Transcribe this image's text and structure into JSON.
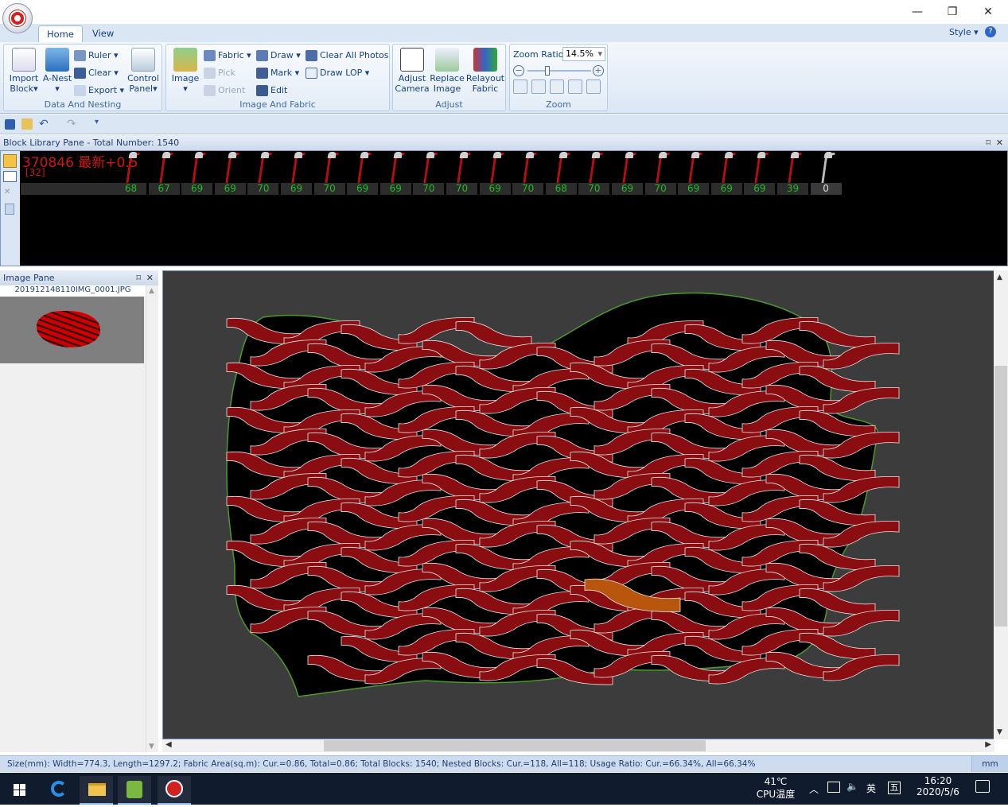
{
  "title_bar": {
    "min": "—",
    "max": "❐",
    "close": "✕"
  },
  "tabs": [
    {
      "label": "Home",
      "active": true
    },
    {
      "label": "View",
      "active": false
    }
  ],
  "style_menu": {
    "label": "Style",
    "help": "?"
  },
  "ribbon": {
    "data_nesting": {
      "label": "Data And Nesting",
      "import_block": "Import\nBlock",
      "import_line1": "Import",
      "import_line2": "Block",
      "anest": "A-Nest",
      "ruler": "Ruler",
      "clear": "Clear",
      "export": "Export",
      "control_line1": "Control",
      "control_line2": "Panel"
    },
    "image_fabric": {
      "label": "Image And Fabric",
      "image": "Image",
      "fabric": "Fabric",
      "pick": "Pick",
      "orient": "Orient",
      "draw": "Draw",
      "mark": "Mark",
      "edit": "Edit",
      "clear_all_photos": "Clear All Photos",
      "draw_lop": "Draw LOP"
    },
    "adjust": {
      "label": "Adjust",
      "adjust_l1": "Adjust",
      "adjust_l2": "Camera",
      "replace_l1": "Replace",
      "replace_l2": "Image",
      "relayout_l1": "Relayout",
      "relayout_l2": "Fabric"
    },
    "zoom": {
      "label": "Zoom",
      "ratio_label": "Zoom Ratio",
      "ratio_value": "14.5%",
      "slider_level": 0.3
    }
  },
  "block_library": {
    "header": "Block Library Pane - Total Number: 1540",
    "first_label": "370846 最新+0.5",
    "first_sub": "[32]",
    "counts": [
      "68",
      "67",
      "69",
      "69",
      "70",
      "69",
      "70",
      "69",
      "69",
      "70",
      "70",
      "69",
      "70",
      "68",
      "70",
      "69",
      "70",
      "69",
      "69",
      "69",
      "39",
      "0"
    ]
  },
  "image_pane": {
    "header": "Image Pane",
    "file": "201912148110IMG_0001.JPG"
  },
  "status": {
    "text": "Size(mm): Width=774.3, Length=1297.2; Fabric Area(sq.m): Cur.=0.86, Total=0.86; Total Blocks: 1540; Nested Blocks: Cur.=118, All=118; Usage Ratio: Cur.=66.34%, All=66.34%",
    "unit": "mm"
  },
  "taskbar": {
    "temp": "41℃",
    "cpu": "CPU温度",
    "ime": "英",
    "ime2": "五",
    "time": "16:20",
    "date": "2020/5/6"
  },
  "colors": {
    "piece": "#8a0d12",
    "highlight": "#b8560e",
    "fabric": "#000000",
    "canvas": "#3c3c3c"
  }
}
